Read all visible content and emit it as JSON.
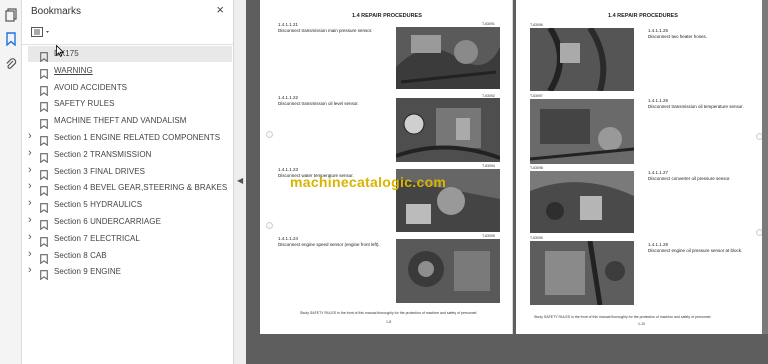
{
  "panel": {
    "title": "Bookmarks",
    "close": "×",
    "items": [
      {
        "label": "DX175",
        "expandable": false,
        "selected": true
      },
      {
        "label": "WARNING",
        "expandable": false,
        "underlined": true
      },
      {
        "label": "AVOID ACCIDENTS",
        "expandable": false
      },
      {
        "label": "SAFETY RULES",
        "expandable": false
      },
      {
        "label": "MACHINE THEFT AND VANDALISM",
        "expandable": false
      },
      {
        "label": "Section 1 ENGINE RELATED COMPONENTS",
        "expandable": true
      },
      {
        "label": "Section 2 TRANSMISSION",
        "expandable": true
      },
      {
        "label": "Section 3 FINAL DRIVES",
        "expandable": true
      },
      {
        "label": "Section 4 BEVEL GEAR,STEERING & BRAKES",
        "expandable": true
      },
      {
        "label": "Section 5 HYDRAULICS",
        "expandable": true
      },
      {
        "label": "Section 6 UNDERCARRIAGE",
        "expandable": true
      },
      {
        "label": "Section 7 ELECTRICAL",
        "expandable": true
      },
      {
        "label": "Section 8 CAB",
        "expandable": true
      },
      {
        "label": "Section 9 ENGINE",
        "expandable": true
      }
    ]
  },
  "rail_icons": [
    "pages-icon",
    "bookmark-icon",
    "attachment-icon"
  ],
  "doc": {
    "left_page": {
      "title": "1.4 REPAIR PROCEDURES",
      "steps": [
        {
          "num": "1.4.1.1.21",
          "text": "Disconnect transmission main pressure sensor.",
          "code": "T-63091"
        },
        {
          "num": "1.4.1.1.22",
          "text": "Disconnect transmission oil level sensor.",
          "code": "T-63092"
        },
        {
          "num": "1.4.1.1.23",
          "text": "Disconnect water temperature sensor.",
          "code": "T-63094"
        },
        {
          "num": "1.4.1.1.24",
          "text": "Disconnect engine speed sensor (engine front left).",
          "code": "T-63095"
        }
      ],
      "footer": "Study SAFETY RULES in the front of this manual thoroughly for the protection of machine and safety of personnel.",
      "folio": "1-8"
    },
    "right_page": {
      "title": "1.4 REPAIR PROCEDURES",
      "steps": [
        {
          "num": "1.4.1.1.25",
          "text": "Disconnect two heater hoses.",
          "code": "T-63096"
        },
        {
          "num": "1.4.1.1.26",
          "text": "Disconnect transmission oil temperature sensor.",
          "code": "T-63097"
        },
        {
          "num": "1.4.1.1.27",
          "text": "Disconnect converter oil pressure sensor.",
          "code": "T-63098"
        },
        {
          "num": "1.4.1.1.28",
          "text": "Disconnect engine oil pressure sensor at block.",
          "code": "T-63099"
        }
      ],
      "footer": "Study SAFETY RULES in the front of this manual thoroughly for the protection of machine and safety of personnel.",
      "folio": "1-10"
    },
    "watermark": "machinecatalogic.com"
  }
}
